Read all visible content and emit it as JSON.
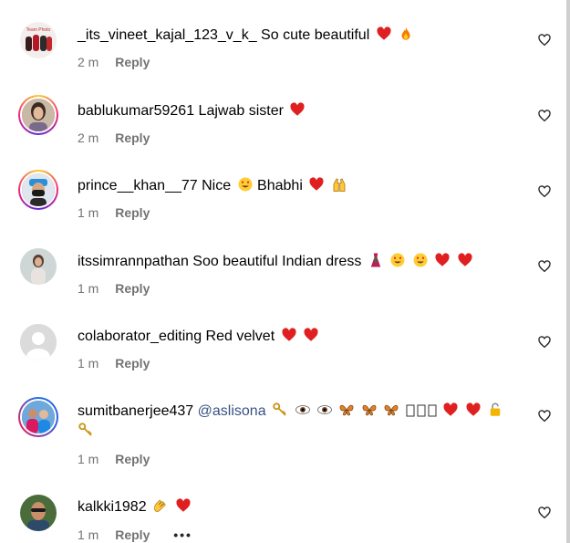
{
  "comments": [
    {
      "username": "_its_vineet_kajal_123_v_k_",
      "mention": "",
      "text": "So cute beautiful",
      "emojis": [
        "red-heart",
        "fire"
      ],
      "time": "2 m",
      "reply": "Reply",
      "avatar": "group-photo"
    },
    {
      "username": "bablukumar59261",
      "mention": "",
      "text": "Lajwab sister",
      "emojis": [
        "red-heart"
      ],
      "time": "2 m",
      "reply": "Reply",
      "avatar": "woman-photo"
    },
    {
      "username": "prince__khan__77",
      "mention": "",
      "text": "Nice",
      "text2": "Bhabhi",
      "emojis": [
        "heart-eyes"
      ],
      "emojis2": [
        "red-heart",
        "raised-hands"
      ],
      "time": "1 m",
      "reply": "Reply",
      "avatar": "man-mask-photo"
    },
    {
      "username": "itssimrannpathan",
      "mention": "",
      "text": "Soo beautiful Indian dress",
      "emojis": [
        "dress",
        "heart-eyes",
        "heart-eyes",
        "red-heart",
        "red-heart"
      ],
      "time": "1 m",
      "reply": "Reply",
      "avatar": "woman-outdoor-photo"
    },
    {
      "username": "colaborator_editing",
      "mention": "",
      "text": "Red velvet",
      "emojis": [
        "red-heart",
        "red-heart"
      ],
      "time": "1 m",
      "reply": "Reply",
      "avatar": "default-avatar"
    },
    {
      "username": "sumitbanerjee437",
      "mention": "@aslisona",
      "text": "",
      "emojis": [
        "key",
        "eye",
        "eye",
        "butterfly",
        "butterfly",
        "butterfly",
        "box",
        "box",
        "box",
        "red-heart",
        "red-heart",
        "lock"
      ],
      "emojis_line2": [
        "key"
      ],
      "time": "1 m",
      "reply": "Reply",
      "avatar": "couple-photo"
    },
    {
      "username": "kalkki1982",
      "mention": "",
      "text": "",
      "emojis": [
        "clapping-hands",
        "red-heart"
      ],
      "time": "1 m",
      "reply": "Reply",
      "more": "•••",
      "avatar": "man-glasses-photo"
    }
  ]
}
